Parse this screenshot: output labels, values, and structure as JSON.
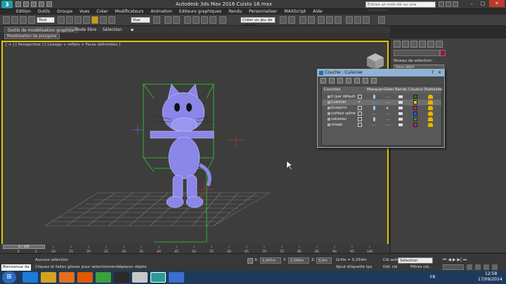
{
  "titlebar": {
    "title": "Autodesk 3ds Max 2016      Cuisto 18.max",
    "search_placeholder": "Entrez un mot-clé ou une expression"
  },
  "menu": [
    "Edition",
    "Outils",
    "Groupe",
    "Vues",
    "Créer",
    "Modificateurs",
    "Animation",
    "Editeurs graphiques",
    "Rendu",
    "Personnaliser",
    "MAXScript",
    "Aide"
  ],
  "toolbar": {
    "filter_select": "Tout",
    "view_select": "Vue",
    "selection_set": "Créer un jeu de sélecti"
  },
  "ribbon": {
    "tabs": [
      "Outils de modélisation graphite",
      "Mode libre",
      "Sélection"
    ],
    "sub_button": "Modélisation de polygone"
  },
  "viewport": {
    "label": "[ + ] [ Perspective ] [ Lissage + reflets + Faces délimitées ]"
  },
  "command_panel": {
    "selection_level_label": "Niveau de sélection :",
    "selection_level_value": "Sous-objet"
  },
  "layer_dialog": {
    "title": "Couche : Cuisinier",
    "columns": [
      "Couches",
      "Masquer",
      "Geler",
      "Rendu",
      "Couleur",
      "Radiosité"
    ],
    "rows": [
      {
        "name": "0 (par défaut)",
        "current": false,
        "hidden": true,
        "frozen": "----",
        "color": "#1a7a1a",
        "selected": false
      },
      {
        "name": "Cuisinier",
        "current": true,
        "hidden": false,
        "frozen": "----",
        "color": "#d8d800",
        "selected": true
      },
      {
        "name": "blueprint",
        "current": false,
        "hidden": true,
        "frozen": "✱",
        "color": "#c02090",
        "selected": false
      },
      {
        "name": "surface spline",
        "current": false,
        "hidden": false,
        "frozen": "----",
        "color": "#2060d0",
        "selected": false
      },
      {
        "name": "vaisseau",
        "current": false,
        "hidden": true,
        "frozen": "----",
        "color": "#20a040",
        "selected": false
      },
      {
        "name": "visage",
        "current": false,
        "hidden": false,
        "frozen": "----",
        "color": "#c0208a",
        "selected": false
      }
    ]
  },
  "timeline": {
    "frame": "0 / 100",
    "ticks": [
      "0",
      "5",
      "10",
      "15",
      "20",
      "25",
      "30",
      "35",
      "40",
      "45",
      "50",
      "55",
      "60",
      "65",
      "70",
      "75",
      "80",
      "85",
      "90",
      "95",
      "100"
    ]
  },
  "status": {
    "welcome": "Bienvenue da",
    "selection": "Aucune sélection",
    "hint": "Cliquez et faites glisser pour sélectionner/déplacer objets",
    "x": "2,047m",
    "y": "1,569m",
    "z": "0,0m",
    "grid": "Grille = 0,254m",
    "add_tag": "Ajout étiquette tps",
    "key_auto": "Clé auto",
    "key_mode": "Sélection",
    "set_key": "Déf. clé",
    "key_filters": "Filtres clé..."
  },
  "taskbar": {
    "lang": "FR",
    "time": "12:58",
    "date": "17/09/2014"
  }
}
